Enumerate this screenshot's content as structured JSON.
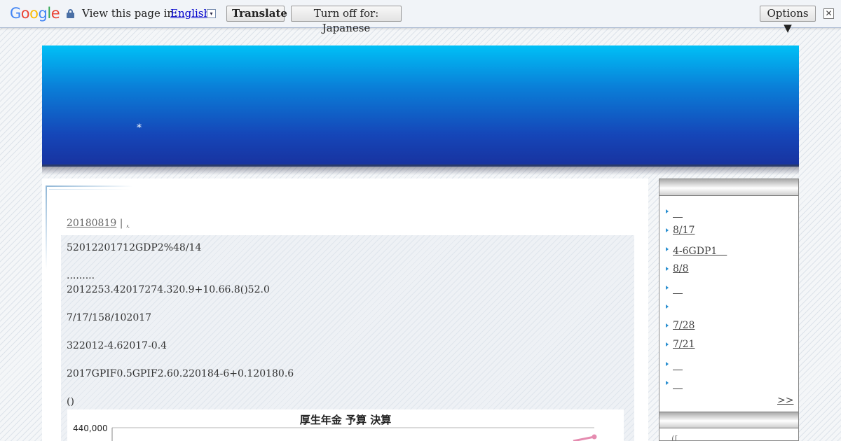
{
  "translate_bar": {
    "logo": "Google",
    "view_text": "View this page in:",
    "language": "English",
    "translate_label": "Translate",
    "turn_off_label": "Turn off for: Japanese",
    "options_label": "Options ▼",
    "close_glyph": "✕",
    "dropdown_glyph": "▾"
  },
  "banner": {
    "star": "*"
  },
  "post": {
    "date": "20180819",
    "separator": "|",
    "category": ",",
    "lines": [
      "52012201712GDP2%48/14",
      ".........",
      "2012253.42017274.320.9+10.66.8()52.0",
      "7/17/158/102017",
      "322012-4.62017-0.4",
      "2017GPIF0.5GPIF2.60.220184-6+0.120180.6",
      "()"
    ]
  },
  "chart_data": {
    "type": "line",
    "title": "厚生年金 予算 決算",
    "yticks": [
      "440,000"
    ],
    "colors": {
      "series": "#e58cb0"
    }
  },
  "sidebar": {
    "items": [
      {
        "label": "　"
      },
      {
        "label": "8/17"
      },
      {
        "label": "4-6GDP1　"
      },
      {
        "label": "8/8"
      },
      {
        "label": "　"
      },
      {
        "label": ""
      },
      {
        "label": "7/28"
      },
      {
        "label": "7/21"
      },
      {
        "label": "　"
      },
      {
        "label": "　"
      }
    ],
    "more_label": ">>",
    "next_section_fragment": "([ "
  }
}
